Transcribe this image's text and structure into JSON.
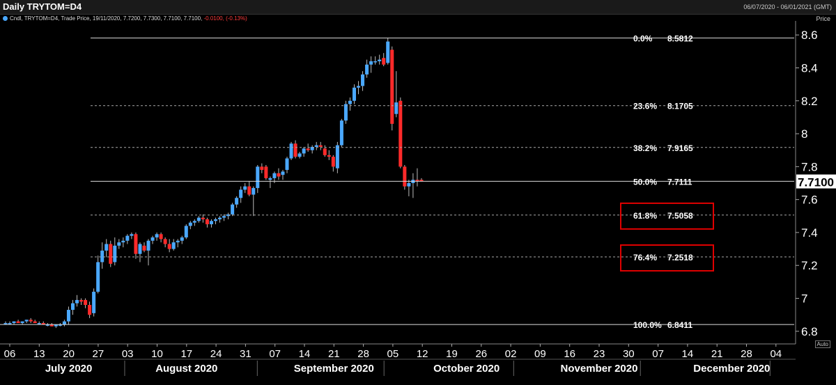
{
  "header": {
    "title": "Daily TRYTOM=D4",
    "date_range": "06/07/2020 - 06/01/2021 (GMT)",
    "legend_prefix": "Cndl, TRYTOM=D4, Trade Price, 19/11/2020, 7.7200, 7.7300, 7.7100, 7.7100,",
    "legend_change": "-0.0100, (-0.13%)",
    "price_label": "Price",
    "auto_label": "Auto"
  },
  "chart_data": {
    "type": "candlestick",
    "title": "Daily TRYTOM=D4",
    "ylim": [
      6.74,
      8.66
    ],
    "yticks": [
      6.8,
      7,
      7.2,
      7.4,
      7.6,
      7.8,
      8,
      8.2,
      8.4,
      8.6
    ],
    "ytick_labels": [
      "6.8",
      "7",
      "7.2",
      "7.4",
      "7.6",
      "7.8",
      "8",
      "8.2",
      "8.4",
      "8.6"
    ],
    "last_price": "7.7100",
    "last_price_value": 7.71,
    "x_day_labels": [
      "06",
      "13",
      "20",
      "27",
      "03",
      "10",
      "17",
      "24",
      "31",
      "07",
      "14",
      "21",
      "28",
      "05",
      "12",
      "19",
      "26",
      "02",
      "09",
      "16",
      "23",
      "30",
      "07",
      "14",
      "21",
      "28",
      "04"
    ],
    "x_month_labels": [
      {
        "label": "July 2020",
        "center_tick": 2
      },
      {
        "label": "August 2020",
        "center_tick": 6
      },
      {
        "label": "September 2020",
        "center_tick": 11
      },
      {
        "label": "October 2020",
        "center_tick": 15.5
      },
      {
        "label": "November 2020",
        "center_tick": 20
      },
      {
        "label": "December 2020",
        "center_tick": 24.5
      }
    ],
    "month_separators": [
      3.9,
      8.4,
      12.7,
      17.1,
      21.4,
      25.8
    ],
    "fibonacci": [
      {
        "pct": "0.0%",
        "value": 8.5812,
        "label": "8.5812",
        "boxed": false
      },
      {
        "pct": "23.6%",
        "value": 8.1705,
        "label": "8.1705",
        "boxed": false
      },
      {
        "pct": "38.2%",
        "value": 7.9165,
        "label": "7.9165",
        "boxed": false
      },
      {
        "pct": "50.0%",
        "value": 7.7111,
        "label": "7.7111",
        "boxed": false
      },
      {
        "pct": "61.8%",
        "value": 7.5058,
        "label": "7.5058",
        "boxed": true
      },
      {
        "pct": "76.4%",
        "value": 7.2518,
        "label": "7.2518",
        "boxed": true
      },
      {
        "pct": "100.0%",
        "value": 6.8411,
        "label": "6.8411",
        "boxed": false
      }
    ],
    "candles": [
      [
        6.85,
        6.86,
        6.84,
        6.85
      ],
      [
        6.85,
        6.86,
        6.84,
        6.85
      ],
      [
        6.85,
        6.86,
        6.84,
        6.86
      ],
      [
        6.86,
        6.87,
        6.85,
        6.85
      ],
      [
        6.85,
        6.86,
        6.84,
        6.86
      ],
      [
        6.86,
        6.87,
        6.85,
        6.87
      ],
      [
        6.87,
        6.88,
        6.85,
        6.86
      ],
      [
        6.86,
        6.87,
        6.85,
        6.85
      ],
      [
        6.85,
        6.86,
        6.84,
        6.85
      ],
      [
        6.85,
        6.86,
        6.84,
        6.84
      ],
      [
        6.84,
        6.85,
        6.83,
        6.84
      ],
      [
        6.84,
        6.85,
        6.83,
        6.83
      ],
      [
        6.83,
        6.84,
        6.82,
        6.84
      ],
      [
        6.84,
        6.85,
        6.83,
        6.84
      ],
      [
        6.84,
        6.87,
        6.83,
        6.86
      ],
      [
        6.86,
        6.95,
        6.84,
        6.93
      ],
      [
        6.93,
        6.99,
        6.9,
        6.97
      ],
      [
        6.97,
        7.02,
        6.95,
        6.99
      ],
      [
        6.99,
        7.0,
        6.96,
        6.98
      ],
      [
        6.99,
        7.0,
        6.94,
        6.96
      ],
      [
        6.96,
        6.98,
        6.88,
        6.9
      ],
      [
        6.91,
        7.06,
        6.89,
        7.04
      ],
      [
        7.04,
        7.26,
        7.03,
        7.22
      ],
      [
        7.22,
        7.34,
        7.18,
        7.29
      ],
      [
        7.29,
        7.36,
        7.25,
        7.33
      ],
      [
        7.33,
        7.35,
        7.19,
        7.21
      ],
      [
        7.22,
        7.37,
        7.2,
        7.32
      ],
      [
        7.32,
        7.36,
        7.3,
        7.34
      ],
      [
        7.34,
        7.37,
        7.31,
        7.35
      ],
      [
        7.35,
        7.39,
        7.33,
        7.38
      ],
      [
        7.38,
        7.4,
        7.36,
        7.39
      ],
      [
        7.39,
        7.4,
        7.24,
        7.27
      ],
      [
        7.27,
        7.34,
        7.22,
        7.33
      ],
      [
        7.32,
        7.34,
        7.28,
        7.29
      ],
      [
        7.29,
        7.36,
        7.2,
        7.35
      ],
      [
        7.35,
        7.38,
        7.33,
        7.37
      ],
      [
        7.37,
        7.4,
        7.35,
        7.39
      ],
      [
        7.39,
        7.4,
        7.34,
        7.36
      ],
      [
        7.36,
        7.37,
        7.31,
        7.33
      ],
      [
        7.33,
        7.36,
        7.28,
        7.3
      ],
      [
        7.3,
        7.36,
        7.29,
        7.34
      ],
      [
        7.34,
        7.36,
        7.31,
        7.35
      ],
      [
        7.35,
        7.38,
        7.33,
        7.37
      ],
      [
        7.37,
        7.45,
        7.36,
        7.44
      ],
      [
        7.44,
        7.47,
        7.42,
        7.46
      ],
      [
        7.46,
        7.48,
        7.44,
        7.47
      ],
      [
        7.47,
        7.5,
        7.46,
        7.49
      ],
      [
        7.49,
        7.51,
        7.46,
        7.48
      ],
      [
        7.48,
        7.49,
        7.43,
        7.45
      ],
      [
        7.45,
        7.48,
        7.43,
        7.47
      ],
      [
        7.47,
        7.49,
        7.45,
        7.48
      ],
      [
        7.48,
        7.5,
        7.46,
        7.49
      ],
      [
        7.49,
        7.51,
        7.47,
        7.5
      ],
      [
        7.5,
        7.52,
        7.48,
        7.51
      ],
      [
        7.51,
        7.58,
        7.5,
        7.57
      ],
      [
        7.57,
        7.62,
        7.55,
        7.61
      ],
      [
        7.61,
        7.68,
        7.58,
        7.66
      ],
      [
        7.66,
        7.7,
        7.64,
        7.68
      ],
      [
        7.68,
        7.71,
        7.62,
        7.63
      ],
      [
        7.63,
        7.68,
        7.5,
        7.67
      ],
      [
        7.67,
        7.81,
        7.64,
        7.8
      ],
      [
        7.8,
        7.82,
        7.76,
        7.78
      ],
      [
        7.8,
        7.81,
        7.72,
        7.73
      ],
      [
        7.72,
        7.74,
        7.67,
        7.73
      ],
      [
        7.73,
        7.77,
        7.7,
        7.76
      ],
      [
        7.76,
        7.79,
        7.72,
        7.74
      ],
      [
        7.75,
        7.78,
        7.72,
        7.77
      ],
      [
        7.78,
        7.86,
        7.76,
        7.85
      ],
      [
        7.85,
        7.95,
        7.84,
        7.94
      ],
      [
        7.94,
        7.96,
        7.85,
        7.86
      ],
      [
        7.86,
        7.89,
        7.85,
        7.88
      ],
      [
        7.88,
        7.92,
        7.86,
        7.91
      ],
      [
        7.91,
        7.94,
        7.89,
        7.9
      ],
      [
        7.9,
        7.93,
        7.88,
        7.92
      ],
      [
        7.92,
        7.95,
        7.9,
        7.93
      ],
      [
        7.93,
        7.95,
        7.9,
        7.92
      ],
      [
        7.91,
        7.93,
        7.86,
        7.87
      ],
      [
        7.87,
        7.9,
        7.84,
        7.86
      ],
      [
        7.86,
        7.87,
        7.77,
        7.8
      ],
      [
        7.79,
        7.95,
        7.76,
        7.93
      ],
      [
        7.93,
        8.09,
        7.92,
        8.08
      ],
      [
        8.08,
        8.2,
        8.06,
        8.18
      ],
      [
        8.18,
        8.22,
        8.14,
        8.2
      ],
      [
        8.2,
        8.3,
        8.18,
        8.28
      ],
      [
        8.28,
        8.32,
        8.24,
        8.29
      ],
      [
        8.29,
        8.38,
        8.26,
        8.36
      ],
      [
        8.36,
        8.45,
        8.34,
        8.42
      ],
      [
        8.42,
        8.47,
        8.37,
        8.44
      ],
      [
        8.44,
        8.47,
        8.42,
        8.44
      ],
      [
        8.44,
        8.48,
        8.42,
        8.45
      ],
      [
        8.46,
        8.49,
        8.41,
        8.42
      ],
      [
        8.43,
        8.58,
        8.42,
        8.56
      ],
      [
        8.51,
        8.53,
        8.02,
        8.06
      ],
      [
        8.12,
        8.38,
        8.1,
        8.19
      ],
      [
        8.2,
        8.22,
        7.79,
        7.8
      ],
      [
        7.8,
        7.81,
        7.66,
        7.68
      ],
      [
        7.68,
        7.72,
        7.62,
        7.7
      ],
      [
        7.7,
        7.76,
        7.61,
        7.72
      ],
      [
        7.72,
        7.79,
        7.68,
        7.71
      ],
      [
        7.72,
        7.73,
        7.71,
        7.71
      ]
    ]
  },
  "colors": {
    "up": "#4aa8ff",
    "down": "#ff2a2a",
    "axis_text": "#ffffff",
    "grid": "#cccccc",
    "fib_box": "#e00000"
  }
}
